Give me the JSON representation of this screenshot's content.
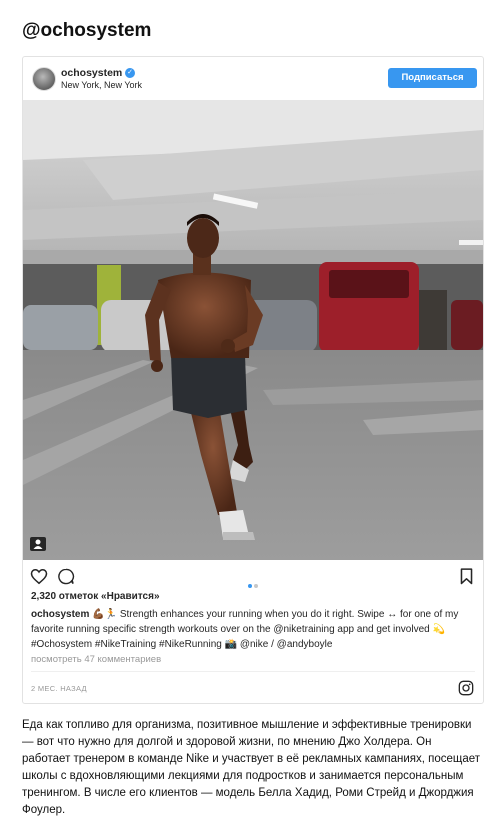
{
  "page": {
    "handle": "@ochosystem"
  },
  "post": {
    "username": "ochosystem",
    "location": "New York, New York",
    "follow_label": "Подписаться",
    "likes": "2,320 отметок «Нравится»",
    "caption": {
      "username": "ochosystem",
      "text": "💪🏾🏃 Strength enhances your running when you do it right. Swipe ↔ for one of my favorite running specific strength workouts over on the @niketraining app and get involved 💫 #Ochosystem #NikeTraining #NikeRunning 📸 @nike / @andyboyle"
    },
    "view_comments": "посмотреть 47 комментариев",
    "time_ago": "2 МЕС. НАЗАД",
    "carousel": {
      "total": 2,
      "active": 1
    }
  },
  "article": {
    "text": "Еда как топливо для организма, позитивное мышление и эффективные тренировки — вот что нужно для долгой и здоровой жизни, по мнению Джо Холдера. Он работает тренером в команде Nike и участвует в её рекламных кампаниях, посещает школы с вдохновляющими лекциями для подростков и занимается персональным тренингом. В числе его клиентов — модель Белла Хадид, Роми Стрейд и Джорджия Фоулер."
  },
  "colors": {
    "accent": "#3897f0",
    "muted": "#999999",
    "text": "#262626"
  },
  "icons": {
    "verified": "verified-badge-icon",
    "heart": "heart-icon",
    "comment": "comment-icon",
    "save": "bookmark-icon",
    "tag": "user-tag-icon",
    "instagram": "instagram-logo-icon"
  }
}
